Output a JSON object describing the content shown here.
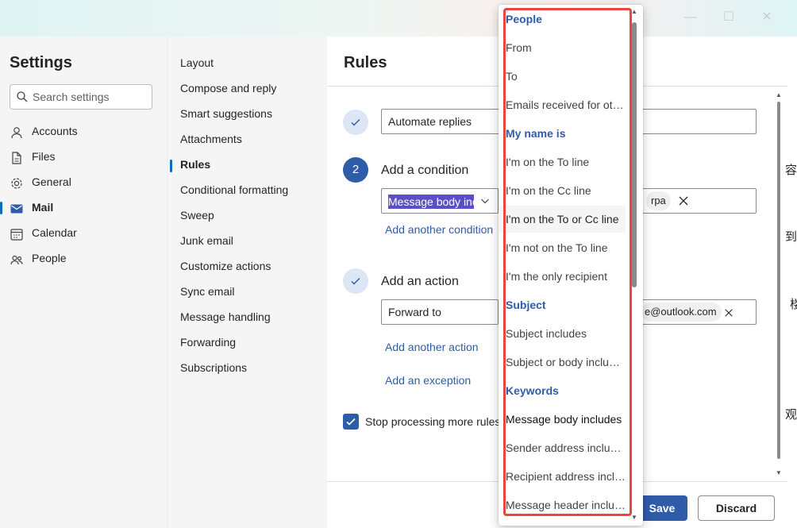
{
  "window": {
    "controls": [
      "—",
      "☐",
      "✕"
    ]
  },
  "settings": {
    "title": "Settings",
    "search_placeholder": "Search settings",
    "nav": [
      {
        "label": "Accounts",
        "icon": "person-icon"
      },
      {
        "label": "Files",
        "icon": "file-icon"
      },
      {
        "label": "General",
        "icon": "gear-icon"
      },
      {
        "label": "Mail",
        "icon": "mail-icon",
        "active": true
      },
      {
        "label": "Calendar",
        "icon": "calendar-icon"
      },
      {
        "label": "People",
        "icon": "people-icon"
      }
    ]
  },
  "mail_settings": {
    "items": [
      "Layout",
      "Compose and reply",
      "Smart suggestions",
      "Attachments",
      "Rules",
      "Conditional formatting",
      "Sweep",
      "Junk email",
      "Customize actions",
      "Sync email",
      "Message handling",
      "Forwarding",
      "Subscriptions"
    ],
    "active": "Rules"
  },
  "rules": {
    "title": "Rules",
    "name_value": "Automate replies",
    "step2_number": "2",
    "condition_title": "Add a condition",
    "condition_select_value": "Message body includes",
    "condition_chip": "rpa",
    "add_condition_link": "Add another condition",
    "action_title": "Add an action",
    "action_select_value": "Forward to",
    "action_chip": "e@outlook.com",
    "add_action_link": "Add another action",
    "add_exception_link": "Add an exception",
    "stop_processing_label": "Stop processing more rules",
    "save_label": "Save",
    "discard_label": "Discard"
  },
  "dropdown": {
    "items": [
      {
        "label": "People",
        "group": true
      },
      {
        "label": "From"
      },
      {
        "label": "To"
      },
      {
        "label": "Emails received for ot…"
      },
      {
        "label": "My name is",
        "group": true
      },
      {
        "label": "I'm on the To line"
      },
      {
        "label": "I'm on the Cc line"
      },
      {
        "label": "I'm on the To or Cc line",
        "hover": true
      },
      {
        "label": "I'm not on the To line"
      },
      {
        "label": "I'm the only recipient"
      },
      {
        "label": "Subject",
        "group": true
      },
      {
        "label": "Subject includes"
      },
      {
        "label": "Subject or body inclu…"
      },
      {
        "label": "Keywords",
        "group": true
      },
      {
        "label": "Message body includes",
        "selected": true
      },
      {
        "label": "Sender address inclu…"
      },
      {
        "label": "Recipient address incl…"
      },
      {
        "label": "Message header inclu…"
      }
    ]
  },
  "background_text": [
    "容",
    "到",
    "楼",
    "观"
  ],
  "colors": {
    "accent": "#2f5ca8",
    "annotation_red": "#e8473f",
    "selection": "#5b4fc7"
  }
}
